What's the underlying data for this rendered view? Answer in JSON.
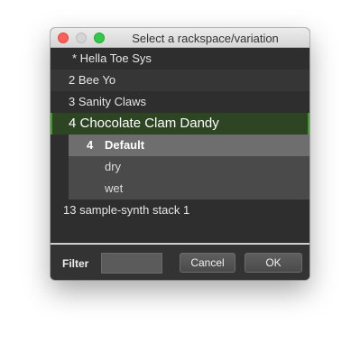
{
  "window": {
    "title": "Select a rackspace/variation"
  },
  "list": {
    "rackspaces": [
      {
        "label": "* Hella Toe Sys"
      },
      {
        "label": "2 Bee Yo"
      },
      {
        "label": "3 Sanity Claws"
      },
      {
        "label": "4 Chocolate Clam Dandy",
        "selected": true
      },
      {
        "label": "13 sample-synth stack 1"
      }
    ],
    "variations": [
      {
        "number": "4",
        "name": "Default",
        "selected": true
      },
      {
        "number": "",
        "name": "dry"
      },
      {
        "number": "",
        "name": "wet"
      }
    ]
  },
  "footer": {
    "filter_label": "Filter",
    "filter_value": "",
    "cancel_label": "Cancel",
    "ok_label": "OK"
  },
  "colors": {
    "selected_rack_bg": "#2d4523",
    "selected_rack_border": "#3e9a2c",
    "selected_variation_bg": "#6e6e6e"
  }
}
